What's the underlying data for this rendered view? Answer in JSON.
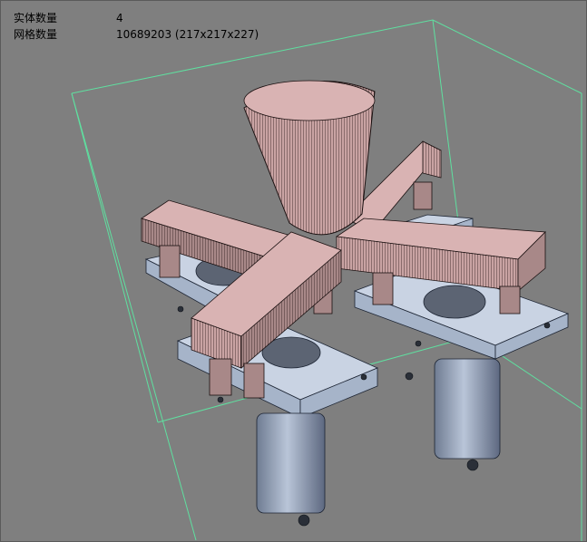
{
  "info": {
    "entity_count_label": "实体数量",
    "entity_count_value": "4",
    "mesh_count_label": "网格数量",
    "mesh_count_value": "10689203 (217x217x227)"
  },
  "colors": {
    "background": "#7f7f7f",
    "bounding_box": "#5fe0a0",
    "shaft": "#c9a3a3",
    "stage": "#c9d3e3"
  }
}
